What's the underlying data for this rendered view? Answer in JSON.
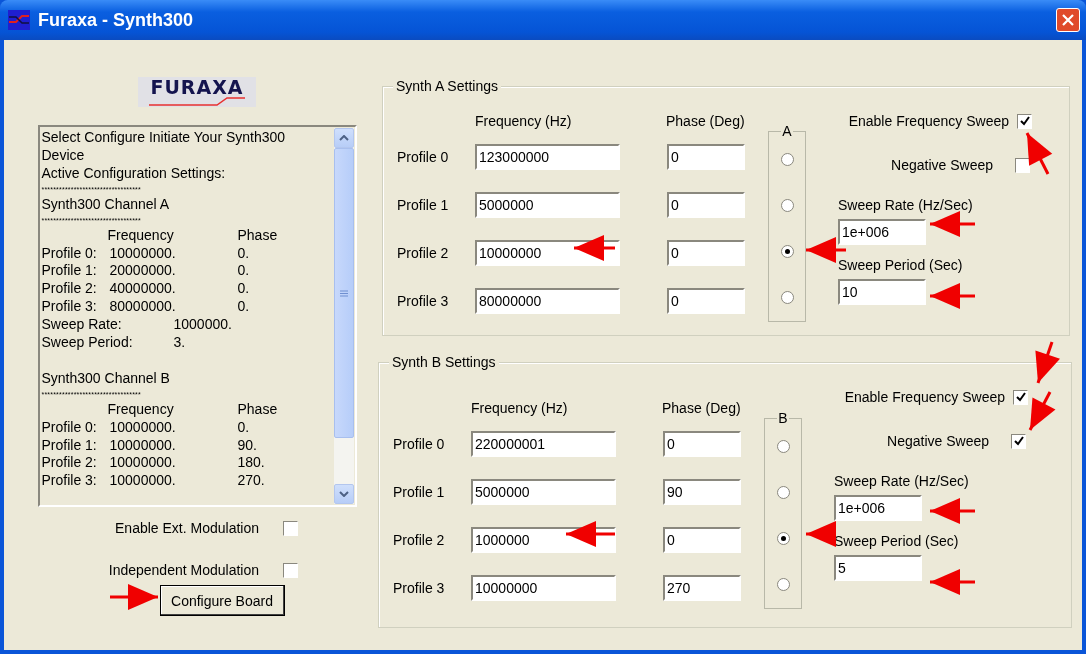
{
  "window": {
    "title": "Furaxa - Synth300"
  },
  "logo": "FURAXA",
  "log": [
    {
      "kind": "text",
      "text": "Select Configure Initiate Your Synth300"
    },
    {
      "kind": "text",
      "text": "Device"
    },
    {
      "kind": "text",
      "text": "Active Configuration Settings:"
    },
    {
      "kind": "stars",
      "text": "**********************************"
    },
    {
      "kind": "text",
      "text": "Synth300 Channel A"
    },
    {
      "kind": "stars",
      "text": "**********************************"
    },
    {
      "kind": "header",
      "cells": [
        "Frequency",
        "Phase"
      ]
    },
    {
      "kind": "row",
      "cells": [
        "Profile 0:",
        "10000000.",
        "0."
      ]
    },
    {
      "kind": "row",
      "cells": [
        "Profile 1:",
        "20000000.",
        "0."
      ]
    },
    {
      "kind": "row",
      "cells": [
        "Profile 2:",
        "40000000.",
        "0."
      ]
    },
    {
      "kind": "row",
      "cells": [
        "Profile 3:",
        "80000000.",
        "0."
      ]
    },
    {
      "kind": "param",
      "cells": [
        "Sweep Rate:",
        "1000000."
      ]
    },
    {
      "kind": "param",
      "cells": [
        "Sweep Period:",
        "3."
      ]
    },
    {
      "kind": "blank"
    },
    {
      "kind": "text",
      "text": "Synth300 Channel B"
    },
    {
      "kind": "stars",
      "text": "**********************************"
    },
    {
      "kind": "header",
      "cells": [
        "Frequency",
        "Phase"
      ]
    },
    {
      "kind": "row",
      "cells": [
        "Profile 0:",
        "10000000.",
        "0."
      ]
    },
    {
      "kind": "row",
      "cells": [
        "Profile 1:",
        "10000000.",
        "90."
      ]
    },
    {
      "kind": "row",
      "cells": [
        "Profile 2:",
        "10000000.",
        "180."
      ]
    },
    {
      "kind": "row",
      "cells": [
        "Profile 3:",
        "10000000.",
        "270."
      ]
    }
  ],
  "options": [
    {
      "label": "Enable Ext. Modulation",
      "checked": false
    },
    {
      "label": "Independent Modulation",
      "checked": false
    }
  ],
  "configure_button": "Configure Board",
  "synths": [
    {
      "title": "Synth A Settings",
      "frequency_header": "Frequency (Hz)",
      "phase_header": "Phase (Deg)",
      "radio_label": "A",
      "profiles": [
        {
          "label": "Profile 0",
          "frequency": "123000000",
          "phase": "0",
          "selected": false
        },
        {
          "label": "Profile 1",
          "frequency": "5000000",
          "phase": "0",
          "selected": false
        },
        {
          "label": "Profile 2",
          "frequency": "10000000",
          "phase": "0",
          "selected": true
        },
        {
          "label": "Profile 3",
          "frequency": "80000000",
          "phase": "0",
          "selected": false
        }
      ],
      "enable_sweep": {
        "label": "Enable Frequency Sweep",
        "checked": true
      },
      "negative_sweep": {
        "label": "Negative Sweep",
        "checked": false
      },
      "sweep_rate": {
        "label": "Sweep Rate (Hz/Sec)",
        "value": "1e+006"
      },
      "sweep_period": {
        "label": "Sweep Period (Sec)",
        "value": "10"
      }
    },
    {
      "title": "Synth B Settings",
      "frequency_header": "Frequency (Hz)",
      "phase_header": "Phase (Deg)",
      "radio_label": "B",
      "profiles": [
        {
          "label": "Profile 0",
          "frequency": "220000001",
          "phase": "0",
          "selected": false
        },
        {
          "label": "Profile 1",
          "frequency": "5000000",
          "phase": "90",
          "selected": false
        },
        {
          "label": "Profile 2",
          "frequency": "1000000",
          "phase": "0",
          "selected": true
        },
        {
          "label": "Profile 3",
          "frequency": "10000000",
          "phase": "270",
          "selected": false
        }
      ],
      "enable_sweep": {
        "label": "Enable Frequency Sweep",
        "checked": true
      },
      "negative_sweep": {
        "label": "Negative Sweep",
        "checked": true
      },
      "sweep_rate": {
        "label": "Sweep Rate (Hz/Sec)",
        "value": "1e+006"
      },
      "sweep_period": {
        "label": "Sweep Period (Sec)",
        "value": "5"
      }
    }
  ]
}
